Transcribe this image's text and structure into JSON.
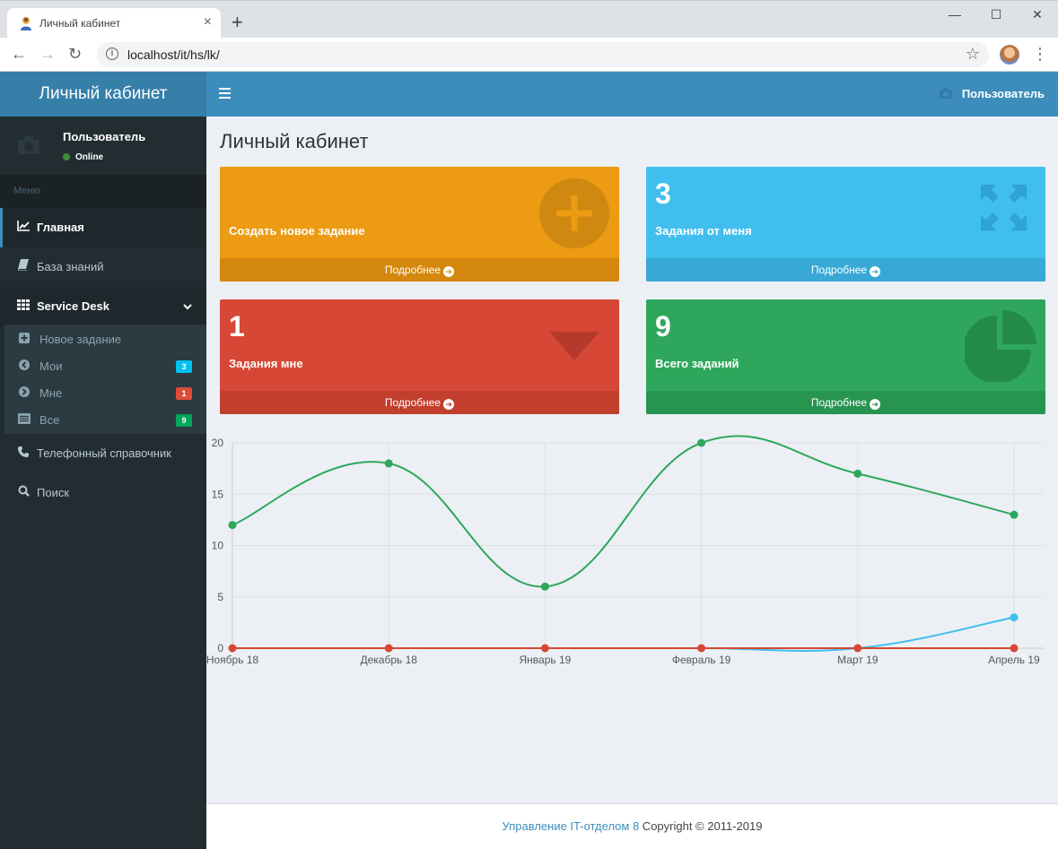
{
  "browser": {
    "tab_title": "Личный кабинет",
    "new_tab": "+",
    "url": "localhost/it/hs/lk/"
  },
  "logo": "Личный кабинет",
  "user": {
    "name": "Пользователь",
    "status": "Online"
  },
  "sidebar": {
    "header": "Меню",
    "items": [
      {
        "label": "Главная",
        "icon": "line-chart-icon"
      },
      {
        "label": "База знаний",
        "icon": "book-icon"
      },
      {
        "label": "Service Desk",
        "icon": "grid-icon"
      },
      {
        "label": "Телефонный справочник",
        "icon": "phone-icon"
      },
      {
        "label": "Поиск",
        "icon": "search-icon"
      }
    ],
    "submenu": [
      {
        "label": "Новое задание",
        "badge": ""
      },
      {
        "label": "Мои",
        "badge": "3",
        "badge_color": "#00c0ef"
      },
      {
        "label": "Мне",
        "badge": "1",
        "badge_color": "#dd4b39"
      },
      {
        "label": "Все",
        "badge": "9",
        "badge_color": "#00a65a"
      }
    ]
  },
  "header": {
    "user": "Пользователь"
  },
  "content": {
    "title": "Личный кабинет",
    "boxes": [
      {
        "num": "",
        "label": "Создать новое задание",
        "more": "Подробнее",
        "color": "#ec9b12",
        "footer_color": "#d4880d"
      },
      {
        "num": "3",
        "label": "Задания от меня",
        "more": "Подробнее",
        "color": "#40bfee",
        "footer_color": "#38a9d6"
      },
      {
        "num": "1",
        "label": "Задания мне",
        "more": "Подробнее",
        "color": "#d64835",
        "footer_color": "#c23f2e"
      },
      {
        "num": "9",
        "label": "Всего заданий",
        "more": "Подробнее",
        "color": "#2ea75c",
        "footer_color": "#279450"
      }
    ]
  },
  "chart_data": {
    "type": "line",
    "categories": [
      "Ноябрь 18",
      "Декабрь 18",
      "Январь 19",
      "Февраль 19",
      "Март 19",
      "Апрель 19"
    ],
    "yticks": [
      "0",
      "5",
      "10",
      "15",
      "20"
    ],
    "ylim": [
      0,
      20
    ],
    "grid": true,
    "series": [
      {
        "values": [
          12,
          18,
          6,
          20,
          17,
          13
        ],
        "color": "#2ea75c"
      },
      {
        "values": [
          0,
          0,
          0,
          0,
          0,
          3
        ],
        "color": "#40bfee"
      },
      {
        "values": [
          0,
          0,
          0,
          0,
          0,
          0
        ],
        "color": "#d64835"
      }
    ]
  },
  "footer": {
    "link": "Управление IT-отделом 8",
    "copyright": " Copyright © 2011-2019"
  }
}
